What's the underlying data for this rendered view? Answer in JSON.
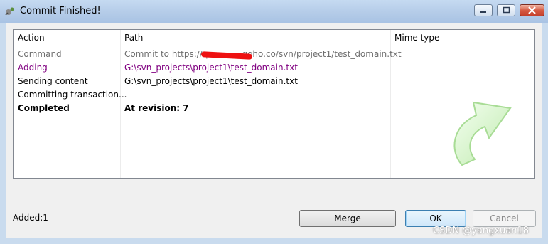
{
  "window": {
    "title": "Commit Finished!"
  },
  "table": {
    "columns": [
      "Action",
      "Path",
      "Mime type"
    ],
    "rows": [
      {
        "action": "Command",
        "path": "Commit to https://q[redacted]goho.co/svn/project1/test_domain.txt",
        "style": "command"
      },
      {
        "action": "Adding",
        "path": "G:\\svn_projects\\project1\\test_domain.txt",
        "style": "added"
      },
      {
        "action": "Sending content",
        "path": "G:\\svn_projects\\project1\\test_domain.txt",
        "style": "normal"
      },
      {
        "action": "Committing transaction...",
        "path": "",
        "style": "normal"
      },
      {
        "action": "Completed",
        "path": "At revision: 7",
        "style": "completed"
      }
    ],
    "command_path_visible": {
      "prefix": "Commit to https://q",
      "suffix": "goho.co/svn/project1/test_domain.txt"
    }
  },
  "status": {
    "summary": "Added:1"
  },
  "buttons": {
    "merge": "Merge",
    "ok": "OK",
    "cancel": "Cancel"
  },
  "watermark": "CSDN @yangxuan18",
  "colors": {
    "added": "#800080",
    "command": "#6e6e6e",
    "accent": "#3c7fb1"
  }
}
